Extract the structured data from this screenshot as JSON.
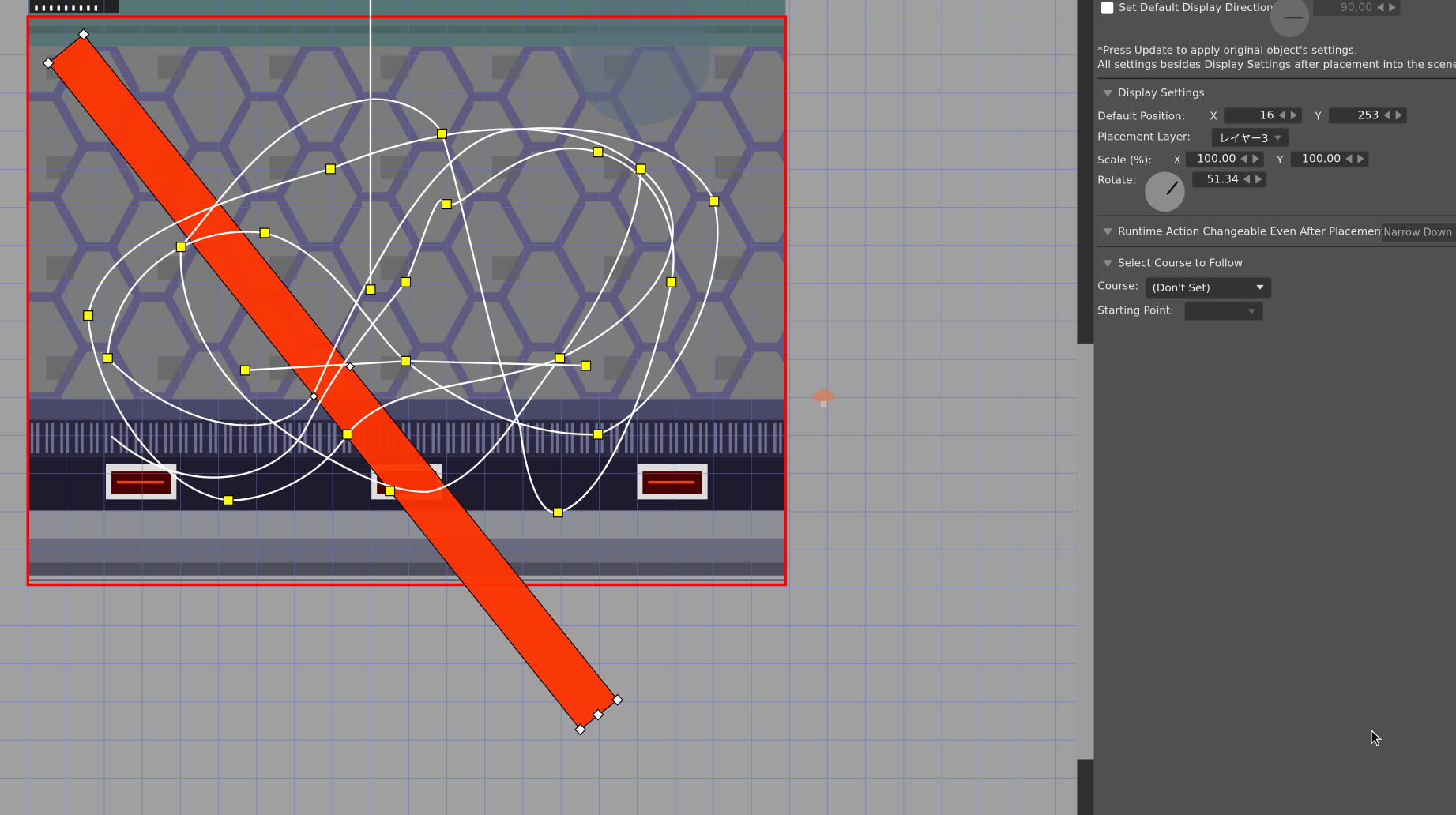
{
  "panel": {
    "default_direction": {
      "label": "Set Default Display Direction",
      "checked": false,
      "value": "90.00"
    },
    "notes": [
      "*Press Update to apply original object's settings.",
      "All settings besides Display Settings after placement into the scene w"
    ],
    "display_settings": {
      "title": "Display Settings",
      "default_position_label": "Default Position:",
      "x_label": "X",
      "y_label": "Y",
      "position_x": "16",
      "position_y": "253",
      "placement_layer_label": "Placement Layer:",
      "placement_layer_value": "レイヤー3",
      "scale_label": "Scale (%):",
      "scale_x": "100.00",
      "scale_y": "100.00",
      "rotate_label": "Rotate:",
      "rotate_value": "51.34"
    },
    "runtime_action": {
      "title": "Runtime Action Changeable Even After Placement",
      "button": "Narrow Down I"
    },
    "course": {
      "title": "Select Course to Follow",
      "course_label": "Course:",
      "course_value": "(Don't Set)",
      "starting_point_label": "Starting Point:",
      "starting_point_value": ""
    }
  },
  "colors": {
    "selection": "#ff3300",
    "scene_border": "#ff0000",
    "handle": "#ffff00",
    "grid": "#5a6fd0"
  }
}
